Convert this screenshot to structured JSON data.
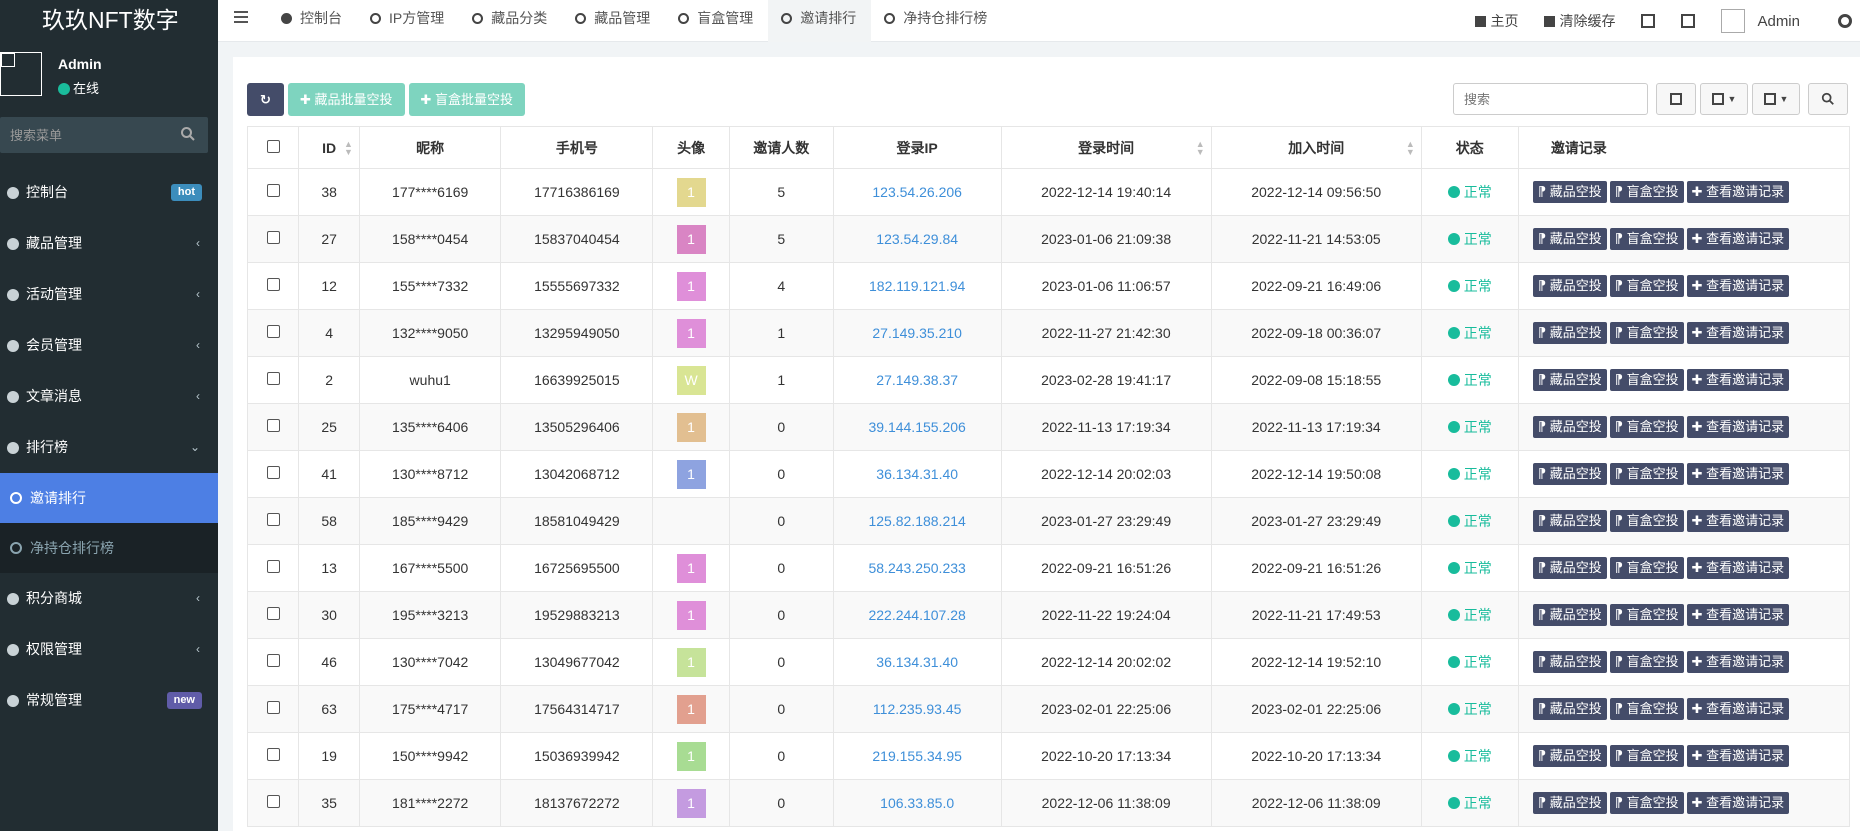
{
  "app": {
    "logo_text": "玖玖NFT数字",
    "user": {
      "name": "Admin",
      "status": "在线"
    },
    "sidebar_search_placeholder": "搜索菜单"
  },
  "sidebar": {
    "items": [
      {
        "label": "控制台",
        "badge": "hot"
      },
      {
        "label": "藏品管理",
        "arrow": "‹"
      },
      {
        "label": "活动管理",
        "arrow": "‹"
      },
      {
        "label": "会员管理",
        "arrow": "‹"
      },
      {
        "label": "文章消息",
        "arrow": "‹"
      },
      {
        "label": "排行榜",
        "arrow": "⌄"
      }
    ],
    "subitems": [
      {
        "label": "邀请排行"
      },
      {
        "label": "净持仓排行榜"
      }
    ],
    "items_after": [
      {
        "label": "积分商城",
        "arrow": "‹"
      },
      {
        "label": "权限管理",
        "arrow": "‹"
      },
      {
        "label": "常规管理",
        "badge": "new"
      }
    ]
  },
  "topbar": {
    "tabs": [
      {
        "label": "控制台"
      },
      {
        "label": "IP方管理"
      },
      {
        "label": "藏品分类"
      },
      {
        "label": "藏品管理"
      },
      {
        "label": "盲盒管理"
      },
      {
        "label": "邀请排行"
      },
      {
        "label": "净持仓排行榜"
      }
    ],
    "home_label": "主页",
    "clear_cache_label": "清除缓存",
    "admin_label": "Admin"
  },
  "toolbar": {
    "batch_airdrop_item": "藏品批量空投",
    "batch_airdrop_box": "盲盒批量空投",
    "search_placeholder": "搜索"
  },
  "table": {
    "columns": [
      "ID",
      "昵称",
      "手机号",
      "头像",
      "邀请人数",
      "登录IP",
      "登录时间",
      "加入时间",
      "状态",
      "邀请记录"
    ],
    "op_labels": [
      "藏品空投",
      "盲盒空投",
      "查看邀请记录"
    ],
    "rows": [
      {
        "id": "38",
        "nick": "177****6169",
        "phone": "17716386169",
        "avatar": "1",
        "avatar_color": "#e3d88f",
        "invites": "5",
        "ip": "123.54.26.206",
        "login_time": "2022-12-14 19:40:14",
        "join_time": "2022-12-14 09:56:50",
        "status": "正常"
      },
      {
        "id": "27",
        "nick": "158****0454",
        "phone": "15837040454",
        "avatar": "1",
        "avatar_color": "#d985c4",
        "invites": "5",
        "ip": "123.54.29.84",
        "login_time": "2023-01-06 21:09:38",
        "join_time": "2022-11-21 14:53:05",
        "status": "正常"
      },
      {
        "id": "12",
        "nick": "155****7332",
        "phone": "15555697332",
        "avatar": "1",
        "avatar_color": "#df8fd9",
        "invites": "4",
        "ip": "182.119.121.94",
        "login_time": "2023-01-06 11:06:57",
        "join_time": "2022-09-21 16:49:06",
        "status": "正常"
      },
      {
        "id": "4",
        "nick": "132****9050",
        "phone": "13295949050",
        "avatar": "1",
        "avatar_color": "#df8fd9",
        "invites": "1",
        "ip": "27.149.35.210",
        "login_time": "2022-11-27 21:42:30",
        "join_time": "2022-09-18 00:36:07",
        "status": "正常"
      },
      {
        "id": "2",
        "nick": "wuhu1",
        "phone": "16639925015",
        "avatar": "W",
        "avatar_color": "#d9e594",
        "invites": "1",
        "ip": "27.149.38.37",
        "login_time": "2023-02-28 19:41:17",
        "join_time": "2022-09-08 15:18:55",
        "status": "正常"
      },
      {
        "id": "25",
        "nick": "135****6406",
        "phone": "13505296406",
        "avatar": "1",
        "avatar_color": "#e2bf91",
        "invites": "0",
        "ip": "39.144.155.206",
        "login_time": "2022-11-13 17:19:34",
        "join_time": "2022-11-13 17:19:34",
        "status": "正常"
      },
      {
        "id": "41",
        "nick": "130****8712",
        "phone": "13042068712",
        "avatar": "1",
        "avatar_color": "#8ea3e0",
        "invites": "0",
        "ip": "36.134.31.40",
        "login_time": "2022-12-14 20:02:03",
        "join_time": "2022-12-14 19:50:08",
        "status": "正常"
      },
      {
        "id": "58",
        "nick": "185****9429",
        "phone": "18581049429",
        "avatar": "",
        "avatar_color": "",
        "invites": "0",
        "ip": "125.82.188.214",
        "login_time": "2023-01-27 23:29:49",
        "join_time": "2023-01-27 23:29:49",
        "status": "正常"
      },
      {
        "id": "13",
        "nick": "167****5500",
        "phone": "16725695500",
        "avatar": "1",
        "avatar_color": "#df8fd9",
        "invites": "0",
        "ip": "58.243.250.233",
        "login_time": "2022-09-21 16:51:26",
        "join_time": "2022-09-21 16:51:26",
        "status": "正常"
      },
      {
        "id": "30",
        "nick": "195****3213",
        "phone": "19529883213",
        "avatar": "1",
        "avatar_color": "#df8fd9",
        "invites": "0",
        "ip": "222.244.107.28",
        "login_time": "2022-11-22 19:24:04",
        "join_time": "2022-11-21 17:49:53",
        "status": "正常"
      },
      {
        "id": "46",
        "nick": "130****7042",
        "phone": "13049677042",
        "avatar": "1",
        "avatar_color": "#c6e39a",
        "invites": "0",
        "ip": "36.134.31.40",
        "login_time": "2022-12-14 20:02:02",
        "join_time": "2022-12-14 19:52:10",
        "status": "正常"
      },
      {
        "id": "63",
        "nick": "175****4717",
        "phone": "17564314717",
        "avatar": "1",
        "avatar_color": "#e2a08f",
        "invites": "0",
        "ip": "112.235.93.45",
        "login_time": "2023-02-01 22:25:06",
        "join_time": "2023-02-01 22:25:06",
        "status": "正常"
      },
      {
        "id": "19",
        "nick": "150****9942",
        "phone": "15036939942",
        "avatar": "1",
        "avatar_color": "#a8dc93",
        "invites": "0",
        "ip": "219.155.34.95",
        "login_time": "2022-10-20 17:13:34",
        "join_time": "2022-10-20 17:13:34",
        "status": "正常"
      },
      {
        "id": "35",
        "nick": "181****2272",
        "phone": "18137672272",
        "avatar": "1",
        "avatar_color": "#c49be0",
        "invites": "0",
        "ip": "106.33.85.0",
        "login_time": "2022-12-06 11:38:09",
        "join_time": "2022-12-06 11:38:09",
        "status": "正常"
      }
    ]
  }
}
